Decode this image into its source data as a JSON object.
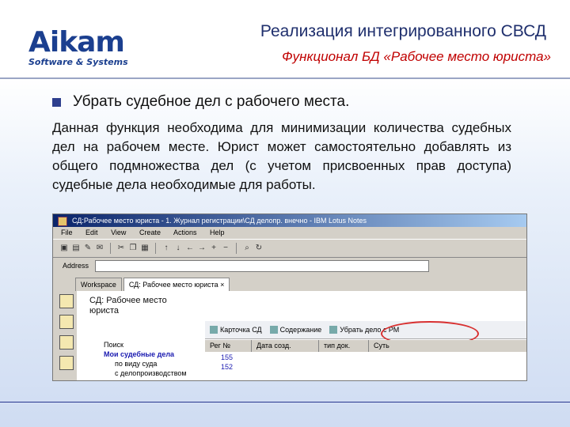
{
  "header": {
    "logo_main": "Aikam",
    "logo_sub": "Software & Systems",
    "title": "Реализация интегрированного СВСД",
    "subtitle": "Функционал БД «Рабочее место юриста»"
  },
  "bullet": "Убрать судебное дел с рабочего места.",
  "paragraph": "Данная функция необходима для минимизации количества судебных дел на рабочем месте. Юрист может самостоятельно добавлять из общего подмножества дел (с учетом  присвоенных прав доступа) судебные дела необходимые для работы.",
  "screenshot": {
    "titlebar": "СД:Рабочее место юриста - 1. Журнал регистрации\\СД делопр. внечно - IBM Lotus Notes",
    "menu": [
      "File",
      "Edit",
      "View",
      "Create",
      "Actions",
      "Help"
    ],
    "address_label": "Address",
    "tabs": [
      "Workspace",
      "СД: Рабочее место юриста ×"
    ],
    "panel_title_1": "СД: Рабочее место",
    "panel_title_2": "юриста",
    "view_actions": [
      "Карточка СД",
      "Содержание",
      "Убрать дело с РМ"
    ],
    "nav": [
      "Поиск",
      "Мои судебные дела",
      "по виду суда",
      "с делопроизводством"
    ],
    "columns": [
      "Рег №",
      "Дата созд.",
      "тип док.",
      "Суть"
    ],
    "rows": [
      "155",
      "152"
    ]
  },
  "colors": {
    "brand": "#1b3f8f",
    "accent": "#c00000",
    "bullet": "#2e3f8e"
  }
}
